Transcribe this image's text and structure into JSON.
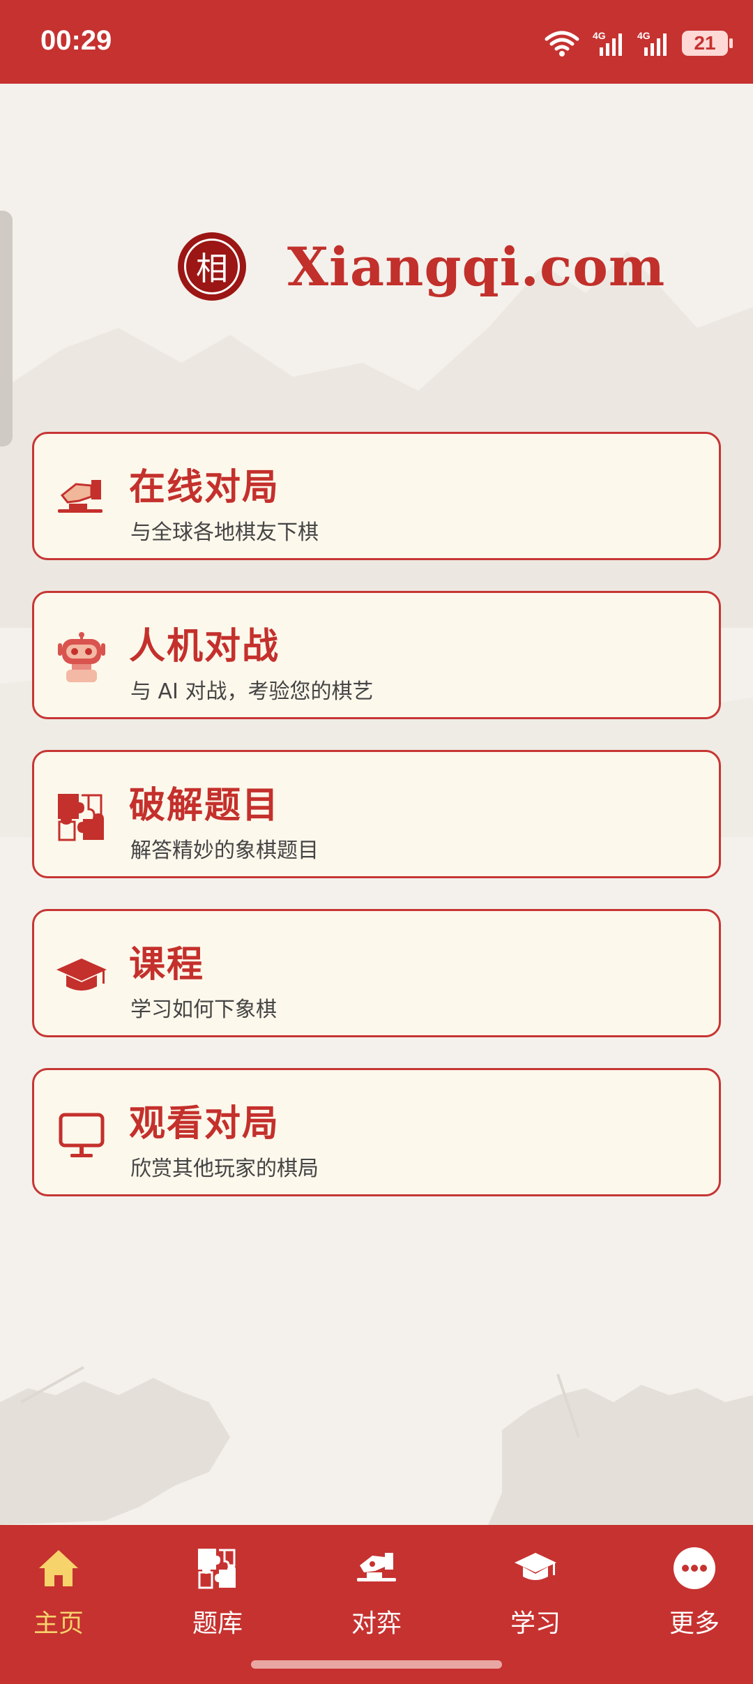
{
  "status_bar": {
    "time": "00:29",
    "battery": "21",
    "icons": [
      "wifi-icon",
      "signal-4g-icon",
      "signal-4g-icon",
      "battery-icon"
    ]
  },
  "brand": {
    "logo_char": "相",
    "name": "Xiangqi.com"
  },
  "menu": [
    {
      "title": "在线对局",
      "subtitle": "与全球各地棋友下棋",
      "icon": "hand-piece-icon"
    },
    {
      "title": "人机对战",
      "subtitle": "与 AI 对战，考验您的棋艺",
      "icon": "robot-icon"
    },
    {
      "title": "破解题目",
      "subtitle": "解答精妙的象棋题目",
      "icon": "puzzle-icon"
    },
    {
      "title": "课程",
      "subtitle": "学习如何下象棋",
      "icon": "graduation-cap-icon"
    },
    {
      "title": "观看对局",
      "subtitle": "欣赏其他玩家的棋局",
      "icon": "monitor-icon"
    }
  ],
  "nav": [
    {
      "label": "主页",
      "icon": "home-icon",
      "active": true
    },
    {
      "label": "题库",
      "icon": "puzzle-icon",
      "active": false
    },
    {
      "label": "对弈",
      "icon": "hand-piece-icon",
      "active": false
    },
    {
      "label": "学习",
      "icon": "graduation-cap-icon",
      "active": false
    },
    {
      "label": "更多",
      "icon": "more-icon",
      "active": false
    }
  ],
  "colors": {
    "primary": "#c53230",
    "card_bg": "#fdf8ec",
    "nav_active": "#f7d36b"
  }
}
